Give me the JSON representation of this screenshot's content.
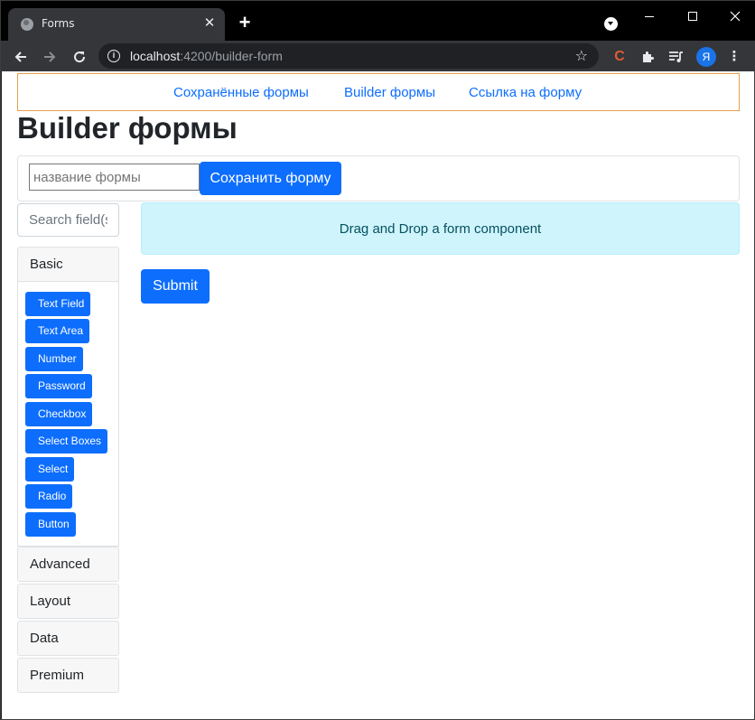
{
  "browser": {
    "tab_title": "Forms",
    "tab_close": "✕",
    "new_tab": "+",
    "url_host": "localhost",
    "url_rest": ":4200/builder-form",
    "avatar_letter": "Я"
  },
  "nav": {
    "links": [
      "Сохранённые формы",
      "Builder формы",
      "Ссылка на форму"
    ]
  },
  "page": {
    "title": "Builder формы",
    "form_name_placeholder": "название формы",
    "save_button": "Сохранить форму",
    "search_placeholder": "Search field(s)",
    "dropzone_text": "Drag and Drop a form component",
    "submit_button": "Submit"
  },
  "sidebar": {
    "groups": [
      "Basic",
      "Advanced",
      "Layout",
      "Data",
      "Premium"
    ],
    "basic_components": [
      "Text Field",
      "Text Area",
      "Number",
      "Password",
      "Checkbox",
      "Select Boxes",
      "Select",
      "Radio",
      "Button"
    ]
  },
  "colors": {
    "primary": "#0d6efd",
    "alert_bg": "#cff4fc",
    "alert_text": "#055160",
    "nav_border": "#e3a24a"
  }
}
